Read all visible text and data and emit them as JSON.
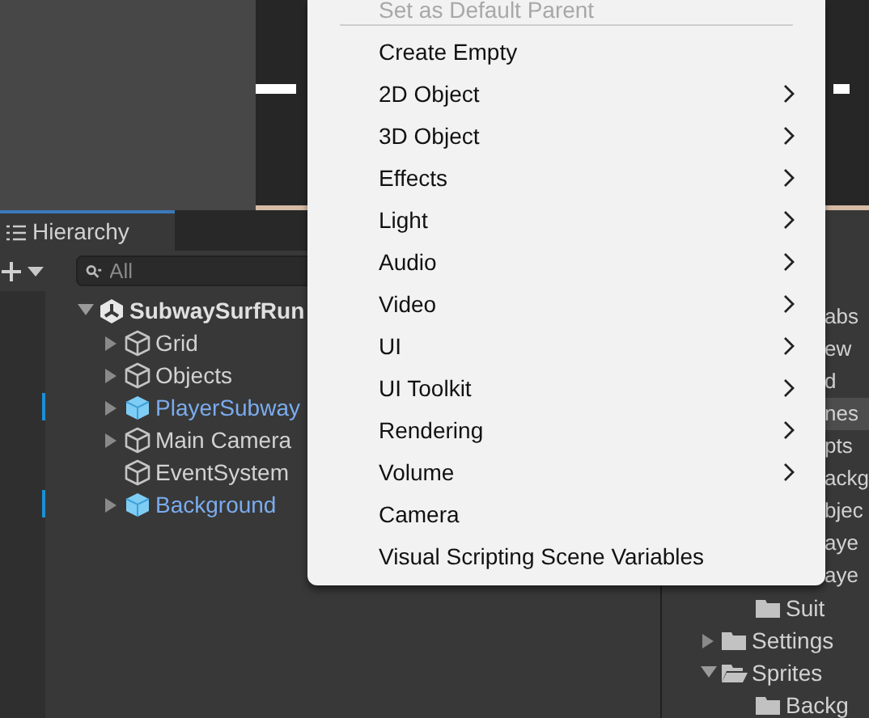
{
  "hierarchy": {
    "tab": {
      "label": "Hierarchy",
      "selected": true
    },
    "search": {
      "placeholder": "All"
    },
    "tree": [
      {
        "label": "SubwaySurfRun",
        "kind": "scene",
        "expanded": true,
        "children": [
          {
            "label": "Grid",
            "kind": "object",
            "expanded": false
          },
          {
            "label": "Objects",
            "kind": "object",
            "expanded": false
          },
          {
            "label": "PlayerSubway",
            "kind": "prefab",
            "expanded": false
          },
          {
            "label": "Main Camera",
            "kind": "object",
            "expanded": false
          },
          {
            "label": "EventSystem",
            "kind": "object"
          },
          {
            "label": "Background",
            "kind": "prefab",
            "expanded": false
          }
        ]
      }
    ]
  },
  "project": {
    "items": [
      {
        "label": "abs",
        "kind": "fragment",
        "selected": false
      },
      {
        "label": "ew",
        "kind": "fragment",
        "selected": false
      },
      {
        "label": "d",
        "kind": "fragment",
        "selected": false
      },
      {
        "label": "nes",
        "kind": "fragment",
        "selected": true
      },
      {
        "label": "pts",
        "kind": "fragment",
        "selected": false
      },
      {
        "label": "ackg",
        "kind": "fragment",
        "selected": false
      },
      {
        "label": "bjec",
        "kind": "fragment",
        "selected": false
      },
      {
        "label": "aye",
        "kind": "fragment",
        "selected": false
      },
      {
        "label": "aye",
        "kind": "fragment",
        "selected": false
      },
      {
        "label": "Suit",
        "kind": "nested_folder",
        "selected": false
      },
      {
        "label": "Settings",
        "kind": "folder",
        "expanded": false,
        "selected": false
      },
      {
        "label": "Sprites",
        "kind": "folder",
        "expanded": true,
        "selected": false
      },
      {
        "label": "Backg",
        "kind": "nested_folder",
        "selected": false
      }
    ]
  },
  "context_menu": {
    "items": [
      {
        "kind": "item",
        "label": "Set as Default Parent",
        "disabled": true,
        "submenu": false
      },
      {
        "kind": "separator"
      },
      {
        "kind": "item",
        "label": "Create Empty",
        "disabled": false,
        "submenu": false
      },
      {
        "kind": "item",
        "label": "2D Object",
        "disabled": false,
        "submenu": true
      },
      {
        "kind": "item",
        "label": "3D Object",
        "disabled": false,
        "submenu": true
      },
      {
        "kind": "item",
        "label": "Effects",
        "disabled": false,
        "submenu": true
      },
      {
        "kind": "item",
        "label": "Light",
        "disabled": false,
        "submenu": true
      },
      {
        "kind": "item",
        "label": "Audio",
        "disabled": false,
        "submenu": true
      },
      {
        "kind": "item",
        "label": "Video",
        "disabled": false,
        "submenu": true
      },
      {
        "kind": "item",
        "label": "UI",
        "disabled": false,
        "submenu": true
      },
      {
        "kind": "item",
        "label": "UI Toolkit",
        "disabled": false,
        "submenu": true
      },
      {
        "kind": "item",
        "label": "Rendering",
        "disabled": false,
        "submenu": true
      },
      {
        "kind": "item",
        "label": "Volume",
        "disabled": false,
        "submenu": true
      },
      {
        "kind": "item",
        "label": "Camera",
        "disabled": false,
        "submenu": false
      },
      {
        "kind": "item",
        "label": "Visual Scripting Scene Variables",
        "disabled": false,
        "submenu": false
      }
    ]
  }
}
